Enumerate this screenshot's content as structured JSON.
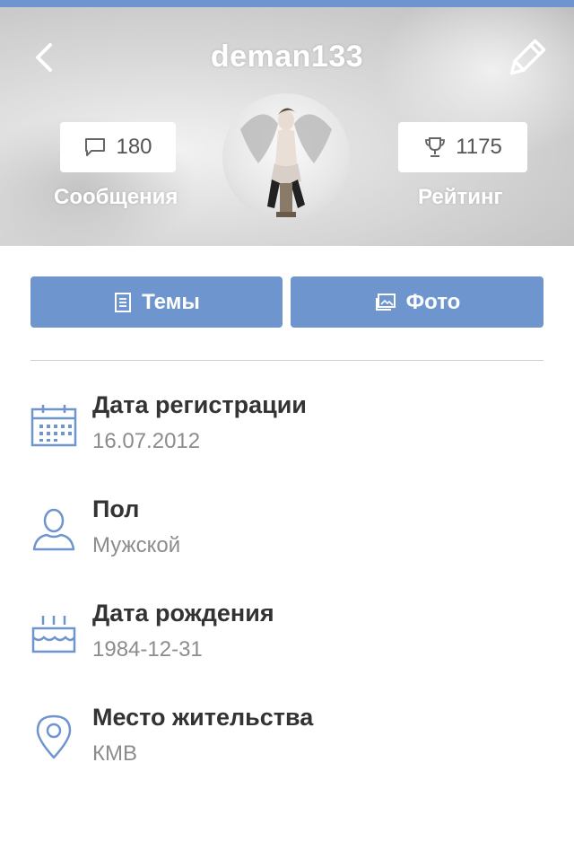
{
  "header": {
    "username": "deman133",
    "messages": {
      "count": "180",
      "label": "Сообщения"
    },
    "rating": {
      "count": "1175",
      "label": "Рейтинг"
    }
  },
  "buttons": {
    "topics_label": "Темы",
    "photos_label": "Фото"
  },
  "info": [
    {
      "label": "Дата регистрации",
      "value": "16.07.2012",
      "icon": "calendar-icon"
    },
    {
      "label": "Пол",
      "value": "Мужской",
      "icon": "user-icon"
    },
    {
      "label": "Дата рождения",
      "value": "1984-12-31",
      "icon": "birthday-cake-icon"
    },
    {
      "label": "Место жительства",
      "value": "КМВ",
      "icon": "location-pin-icon"
    }
  ],
  "colors": {
    "accent": "#6f95cf",
    "label_text": "#333333",
    "value_text": "#8c8c8c"
  }
}
